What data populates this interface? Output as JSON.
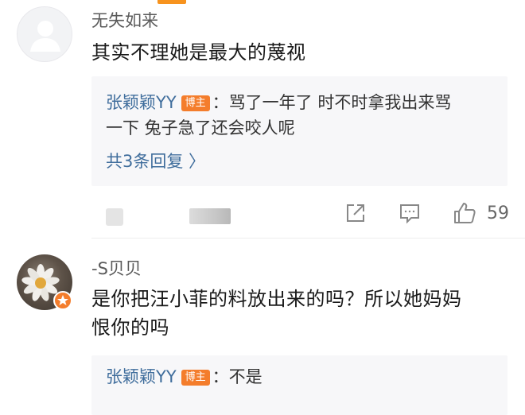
{
  "comments": [
    {
      "username": "无失如来",
      "text": "其实不理她是最大的蔑视",
      "reply": {
        "author": "张颖颖YY",
        "badge": "博主",
        "separator": "：",
        "text_line1": "骂了一年了 时不时拿我出来骂",
        "text_line2": "一下 兔子急了还会咬人呢",
        "more_label": "共3条回复 〉"
      },
      "actions": {
        "repost_icon": "share-icon",
        "comment_icon": "comment-icon",
        "like_icon": "thumbs-up-icon",
        "like_count": "59"
      }
    },
    {
      "username": "-S贝贝",
      "text_line1": "是你把汪小菲的料放出来的吗？所以她妈妈",
      "text_line2": "恨你的吗",
      "reply": {
        "author": "张颖颖YY",
        "badge": "博主",
        "separator": "：",
        "text": "不是"
      }
    }
  ],
  "colors": {
    "accent": "#f47d2c",
    "link": "#3f6d9c",
    "reply_bg": "#f7f7f9"
  }
}
